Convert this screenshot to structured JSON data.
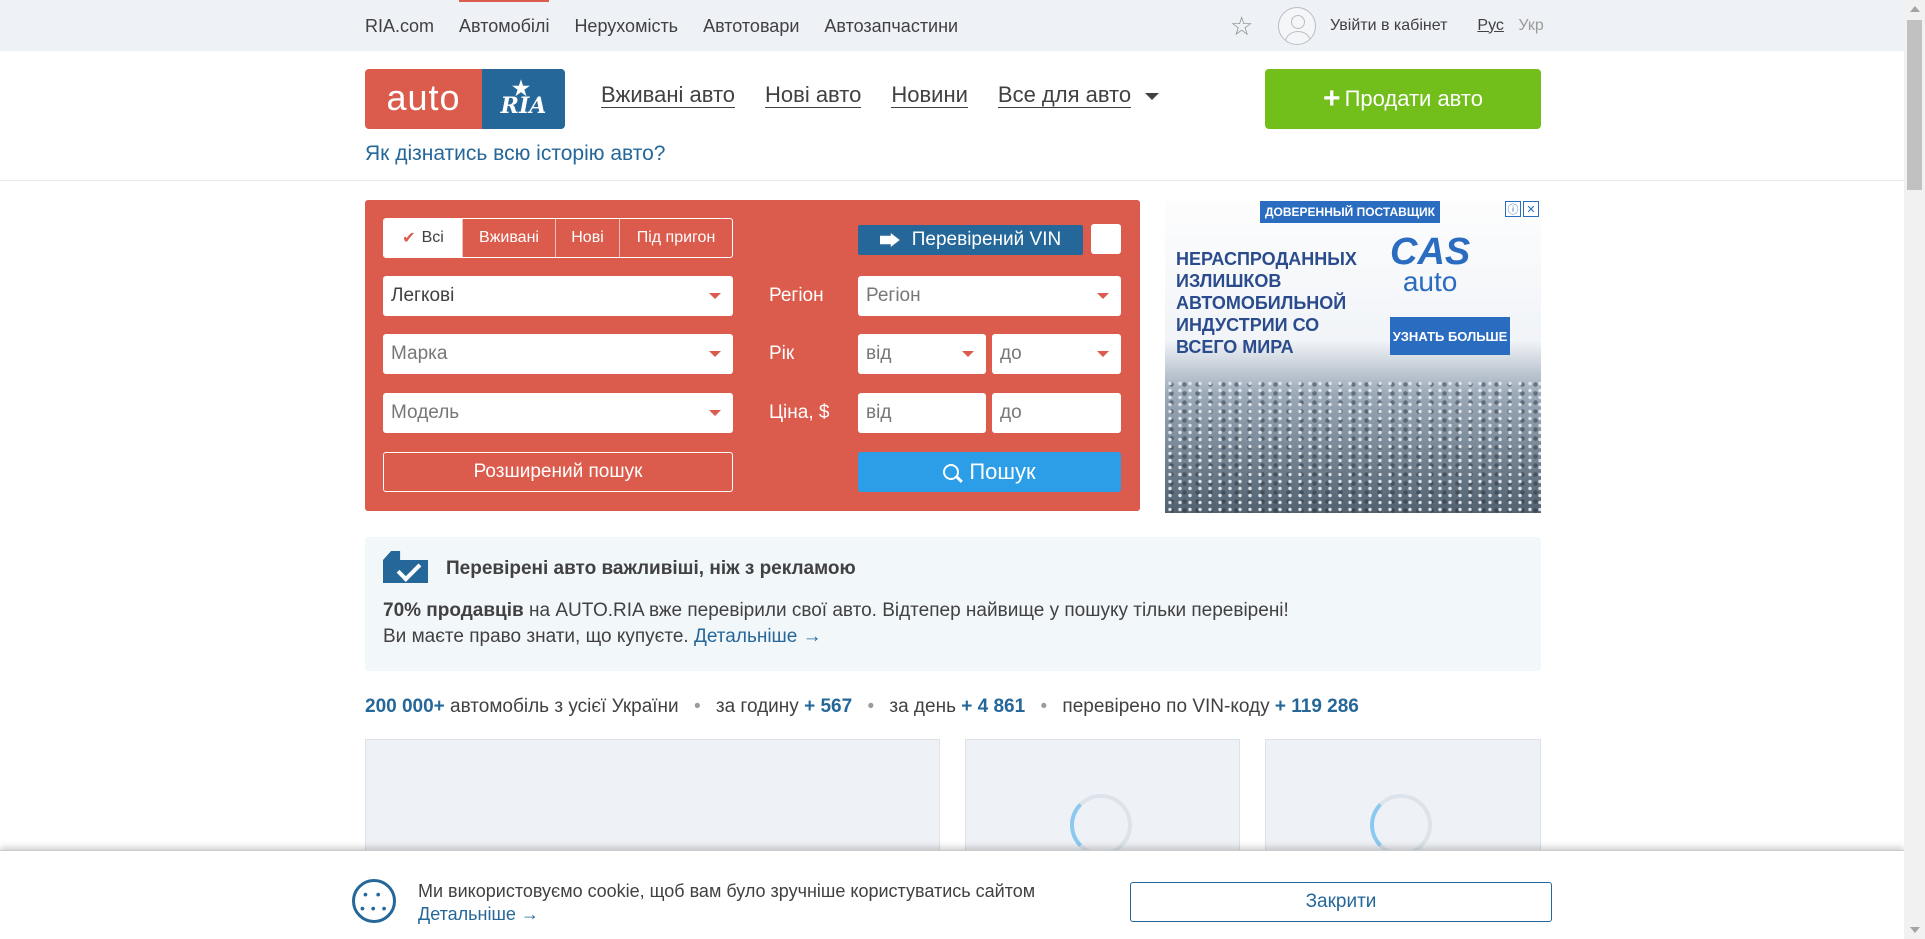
{
  "topbar": {
    "links": [
      "RIA.com",
      "Автомобілі",
      "Нерухомість",
      "Автотовари",
      "Автозапчастини"
    ],
    "active": "Автомобілі",
    "login": "Увійти в кабінет",
    "lang_ru": "Рус",
    "lang_uk": "Укр"
  },
  "header": {
    "logo_auto": "auto",
    "logo_ria": "RIA",
    "nav": [
      "Вживані авто",
      "Нові авто",
      "Новини",
      "Все для авто"
    ],
    "sell_label": "Продати авто",
    "history_link": "Як дізнатись всю історію авто?"
  },
  "search": {
    "tabs": [
      "Всі",
      "Вживані",
      "Нові",
      "Під пригон"
    ],
    "active_tab": "Всі",
    "vin_label": "Перевірений VIN",
    "category_value": "Легкові",
    "brand_placeholder": "Марка",
    "model_placeholder": "Модель",
    "region_label": "Регіон",
    "region_placeholder": "Регіон",
    "year_label": "Рік",
    "year_from": "від",
    "year_to": "до",
    "price_label": "Ціна, $",
    "price_from": "від",
    "price_to": "до",
    "advanced_label": "Розширений пошук",
    "search_label": "Пошук"
  },
  "ad": {
    "supplier": "ДОВЕРЕННЫЙ ПОСТАВЩИК",
    "headline": "НЕРАСПРОДАННЫХ ИЗЛИШКОВ АВТОМОБИЛЬНОЙ ИНДУСТРИИ СО ВСЕГО МИРА",
    "brand": "CAS",
    "brand_sub": "auto",
    "cta": "УЗНАТЬ БОЛЬШЕ",
    "info_icon": "ⓘ",
    "close_icon": "✕"
  },
  "info": {
    "title": "Перевірені авто важливіші, ніж з рекламою",
    "line1_bold": "70% продавців",
    "line1_rest": " на AUTO.RIA вже перевірили свої авто. Відтепер найвище у пошуку тільки перевірені!",
    "line2_text": "Ви маєте право знати, що купуєте. ",
    "line2_link": "Детальніше →"
  },
  "stats": {
    "total": "200 000+",
    "total_text": " автомобіль з усієї України",
    "hour_text": "за годину ",
    "hour": "+ 567",
    "day_text": "за день ",
    "day": "+ 4 861",
    "vin_text": "перевірено по VIN-коду ",
    "vin": "+ 119 286"
  },
  "cookie": {
    "text": "Ми використовуємо cookie, щоб вам було зручніше користуватись сайтом",
    "details": "Детальніше →",
    "close": "Закрити"
  },
  "colors": {
    "brand_red": "#db5c4c",
    "brand_blue": "#256799",
    "sell_green": "#72be1b",
    "search_blue": "#2c9de7"
  }
}
